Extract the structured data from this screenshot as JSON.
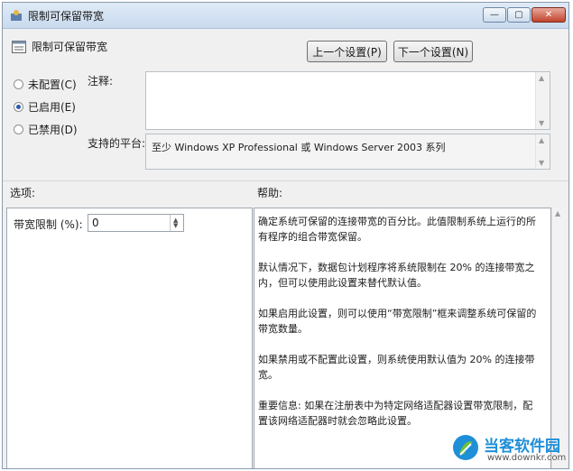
{
  "window": {
    "title": "限制可保留带宽",
    "controls": {
      "minimize": "—",
      "maximize": "▢",
      "close": "✕"
    }
  },
  "header": {
    "policy_name": "限制可保留带宽",
    "prev_button": "上一个设置(P)",
    "next_button": "下一个设置(N)"
  },
  "state": {
    "options": [
      {
        "label": "未配置(C)",
        "selected": false
      },
      {
        "label": "已启用(E)",
        "selected": true
      },
      {
        "label": "已禁用(D)",
        "selected": false
      }
    ]
  },
  "comment": {
    "label": "注释:",
    "value": ""
  },
  "platform": {
    "label": "支持的平台:",
    "value": "至少 Windows XP Professional 或 Windows Server 2003 系列"
  },
  "options_section": {
    "label": "选项:",
    "field_label": "带宽限制 (%):",
    "field_value": "0"
  },
  "help_section": {
    "label": "帮助:",
    "paragraphs": [
      "确定系统可保留的连接带宽的百分比。此值限制系统上运行的所有程序的组合带宽保留。",
      "默认情况下，数据包计划程序将系统限制在 20% 的连接带宽之内，但可以使用此设置来替代默认值。",
      "如果启用此设置，则可以使用“带宽限制”框来调整系统可保留的带宽数量。",
      "如果禁用或不配置此设置，则系统使用默认值为 20% 的连接带宽。",
      "重要信息: 如果在注册表中为特定网络适配器设置带宽限制，配置该网络适配器时就会忽略此设置。"
    ]
  },
  "watermark": {
    "title": "当客软件园",
    "url": "www.downkr.com"
  },
  "colors": {
    "accent": "#2b5aa8",
    "watermark_blue": "#1f8fd8",
    "watermark_green": "#6fc13a"
  }
}
